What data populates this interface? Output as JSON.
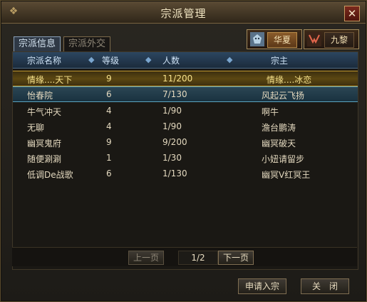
{
  "window": {
    "title": "宗派管理"
  },
  "tabs": [
    {
      "label": "宗派信息"
    },
    {
      "label": "宗派外交"
    }
  ],
  "factions": [
    {
      "label": "华夏",
      "icon": "wolf-head-icon"
    },
    {
      "label": "九黎",
      "icon": "horns-icon"
    }
  ],
  "table": {
    "headers": [
      "宗派名称",
      "等级",
      "人数",
      "宗主"
    ],
    "rows": [
      {
        "name": "情缘....天下",
        "level": "9",
        "members": "11/200",
        "leader": "情缘....冰恋"
      },
      {
        "name": "怡春院",
        "level": "6",
        "members": "7/130",
        "leader": "风起云飞扬"
      },
      {
        "name": "牛气冲天",
        "level": "4",
        "members": "1/90",
        "leader": "啊牛"
      },
      {
        "name": "无聊",
        "level": "4",
        "members": "1/90",
        "leader": "澹台鹏涛"
      },
      {
        "name": "幽冥鬼府",
        "level": "9",
        "members": "9/200",
        "leader": "幽冥破天"
      },
      {
        "name": "随便涮涮",
        "level": "1",
        "members": "1/30",
        "leader": "小妞请留步"
      },
      {
        "name": "低调De战歌",
        "level": "6",
        "members": "1/130",
        "leader": "幽冥V红冥王"
      }
    ]
  },
  "pager": {
    "prev": "上一页",
    "page": "1/2",
    "next": "下一页"
  },
  "actions": {
    "apply": "申请入宗",
    "close": "关　闭"
  },
  "colors": {
    "accent": "#c39a2f",
    "header": "#2c4660"
  }
}
